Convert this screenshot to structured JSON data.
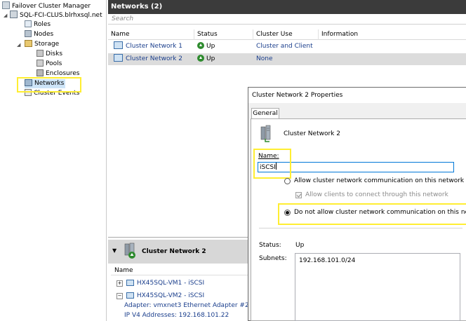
{
  "tree": {
    "root": "Failover Cluster Manager",
    "cluster": "SQL-FCI-CLUS.blrhxsql.net",
    "roles": "Roles",
    "nodes": "Nodes",
    "storage": "Storage",
    "disks": "Disks",
    "pools": "Pools",
    "enclosures": "Enclosures",
    "networks": "Networks",
    "cluster_events": "Cluster Events"
  },
  "networks_panel": {
    "title": "Networks (2)",
    "search_placeholder": "Search",
    "columns": [
      "Name",
      "Status",
      "Cluster Use",
      "Information"
    ],
    "rows": [
      {
        "name": "Cluster Network 1",
        "status": "Up",
        "cluster_use": "Cluster and Client",
        "information": ""
      },
      {
        "name": "Cluster Network 2",
        "status": "Up",
        "cluster_use": "None",
        "information": ""
      }
    ]
  },
  "detail_pane": {
    "title": "Cluster Network 2",
    "column": "Name",
    "items": [
      {
        "label": "HX45SQL-VM1 - iSCSI",
        "expander": "+"
      },
      {
        "label": "HX45SQL-VM2 - iSCSI",
        "expander": "−"
      }
    ],
    "adapter": "Adapter: vmxnet3 Ethernet Adapter #2",
    "ipv4": "IP V4 Addresses: 192.168.101.22"
  },
  "dialog": {
    "title": "Cluster Network 2 Properties",
    "tab": "General",
    "network_name": "Cluster Network 2",
    "name_label": "Name:",
    "name_value": "iSCSI",
    "option_allow": "Allow cluster network communication on this network",
    "option_clients": "Allow clients to connect through this network",
    "option_deny": "Do not allow cluster network communication on this network",
    "status_label": "Status:",
    "status_value": "Up",
    "subnets_label": "Subnets:",
    "subnet_value": "192.168.101.0/24"
  },
  "colors": {
    "header_bg": "#3b3b3b",
    "highlight": "#ffee32",
    "link": "#1a3e8c",
    "status_up": "#2e8b2e"
  }
}
